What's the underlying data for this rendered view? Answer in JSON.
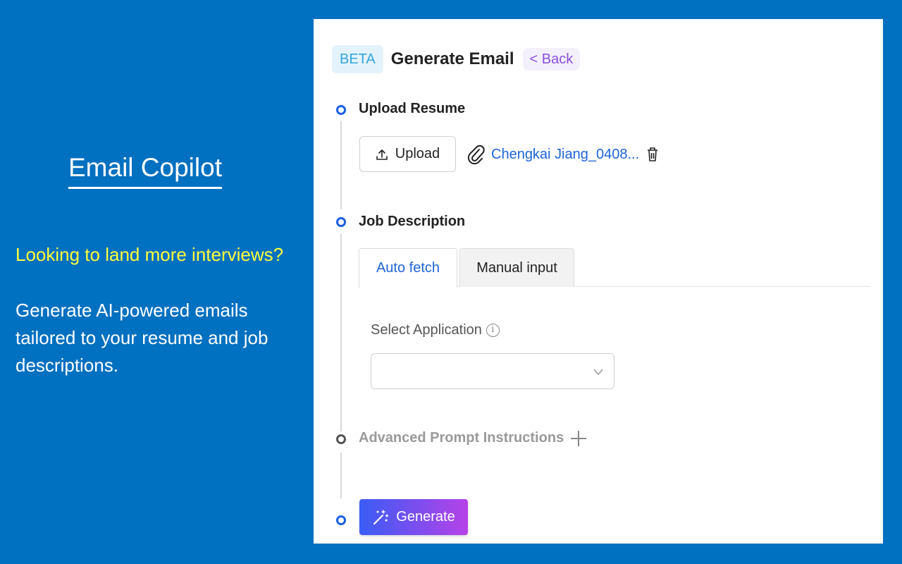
{
  "promo": {
    "title": "Email Copilot",
    "tagline": "Looking to land more interviews?",
    "description": "Generate AI-powered emails tailored to your resume and job descriptions."
  },
  "panel": {
    "badge": "BETA",
    "title": "Generate Email",
    "back_label": "< Back",
    "steps": {
      "upload": {
        "title": "Upload Resume",
        "button_label": "Upload",
        "file_name": "Chengkai Jiang_0408..."
      },
      "job": {
        "title": "Job Description",
        "tabs": [
          "Auto fetch",
          "Manual input"
        ],
        "active_tab": "Auto fetch",
        "select_label": "Select Application",
        "select_value": ""
      },
      "advanced": {
        "title": "Advanced Prompt Instructions"
      },
      "generate": {
        "button_label": "Generate"
      }
    }
  },
  "colors": {
    "background": "#0070c0",
    "tagline": "#ffff3c",
    "link": "#1c64d8",
    "step_dot": "#1b5fe0",
    "generate_gradient_start": "#3a5cf5",
    "generate_gradient_end": "#b642e8"
  },
  "icons": {
    "upload": "upload-icon",
    "attachment": "paperclip-icon",
    "delete": "trash-icon",
    "info": "info-icon",
    "dropdown": "chevron-down-icon",
    "expand": "plus-icon",
    "generate": "magic-wand-icon"
  }
}
